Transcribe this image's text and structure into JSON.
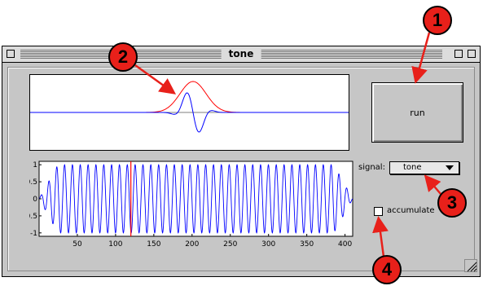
{
  "window": {
    "title": "tone"
  },
  "controls": {
    "run_label": "run",
    "signal_label": "signal:",
    "signal_value": "tone",
    "accumulate_label": "accumulate",
    "accumulate_checked": false
  },
  "callouts": [
    "1",
    "2",
    "3",
    "4"
  ],
  "colors": {
    "callout": "#e8201a",
    "arrow": "#e8201a",
    "trace_blue": "#0000ff",
    "trace_red": "#ff0000",
    "window_bg": "#c6c6c6"
  },
  "chart_data": [
    {
      "type": "line",
      "title": "",
      "series": [
        {
          "color": "#ff0000",
          "shape": "envelope peak",
          "peak_x_fraction": 0.5
        },
        {
          "color": "#0000ff",
          "shape": "oscillating pulse",
          "peak_x_fraction": 0.5
        }
      ],
      "grid": false
    },
    {
      "type": "line",
      "title": "",
      "x_ticks": [
        50,
        100,
        150,
        200,
        250,
        300,
        350,
        400
      ],
      "y_ticks": [
        1,
        0.5,
        0,
        -0.5,
        -1
      ],
      "xlim": [
        0,
        410
      ],
      "ylim": [
        -1.1,
        1.1
      ],
      "series": [
        {
          "color": "#0000ff",
          "shape": "tone",
          "cycles": 40,
          "amplitude": 1.0
        }
      ],
      "cursor_x": 120,
      "cursor_color": "#ff0000",
      "grid": false
    }
  ]
}
